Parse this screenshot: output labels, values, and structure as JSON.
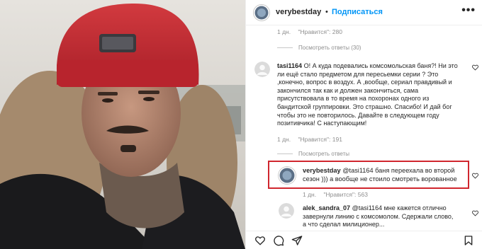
{
  "header": {
    "username": "verybestday",
    "separator": "•",
    "follow_label": "Подписаться",
    "more_label": "•••"
  },
  "top_comment_meta": {
    "age": "1 дн.",
    "likes": "\"Нравится\": 280",
    "view_replies": "Посмотреть ответы (30)"
  },
  "comment_tasi": {
    "user": "tasi1164",
    "lines": [
      "О! А куда подевались комсомольская баня?! Ни это",
      "ли ещё стало предметом для пересьемки серии ? Это",
      ",конечно, вопрос в воздух. А ,вообще, сериал правдивый и",
      "закончился так как и должен закончиться, сама",
      "присутствовала в то время на похоронах одного из",
      "бандитской группировки. Это страшно. Спасибо! И дай бог",
      "чтобы это не повторилось. Давайте в следующем году",
      "позитивчика! С наступающим!"
    ],
    "age": "1 дн.",
    "likes": "\"Нравится\": 191",
    "view_replies": "Посмотреть ответы"
  },
  "reply_verybestday": {
    "user": "verybestday",
    "line1": "@tasi1164 баня переехала во второй",
    "line2": "сезон ))) а вообще не стоило смотреть ворованное",
    "age": "1 дн.",
    "likes": "\"Нравится\": 563"
  },
  "comment_alek": {
    "user": "alek_sandra_07",
    "line1": "@tasi1164 мне кажется отлично",
    "line2": "завернули линию с комсомолом. Сдержали слово,",
    "line3": "а что сделал милиционер..."
  },
  "colors": {
    "accent": "#0095f6",
    "highlight_box": "#d0262e",
    "meta_text": "#8e8e8e"
  }
}
